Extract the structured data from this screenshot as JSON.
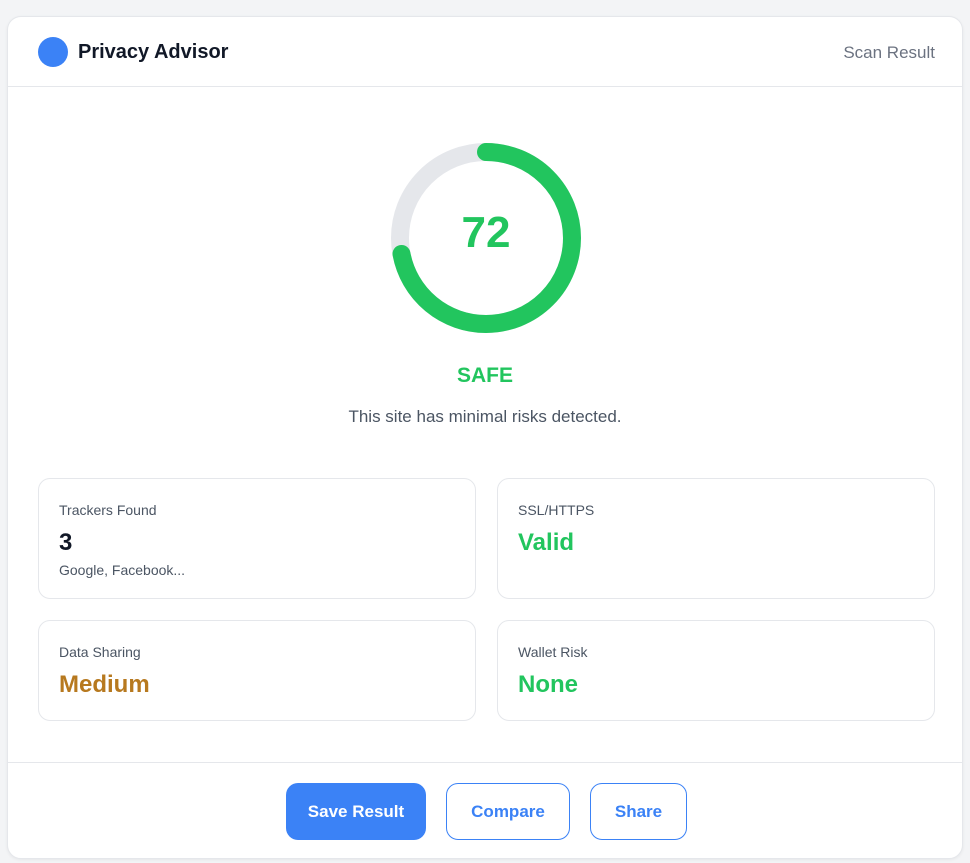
{
  "app": {
    "title": "Privacy Advisor",
    "header_right": "Scan Result"
  },
  "score": {
    "value": 72,
    "max": 100,
    "status": "SAFE",
    "description": "This site has minimal risks detected."
  },
  "stats": [
    {
      "title": "Trackers Found",
      "value": "3",
      "sub": "Google, Facebook...",
      "color": "#111827"
    },
    {
      "title": "SSL/HTTPS",
      "value": "Valid",
      "sub": "",
      "color": "#22c55e"
    },
    {
      "title": "Data Sharing",
      "value": "Medium",
      "sub": "",
      "color": "#b7791f"
    },
    {
      "title": "Wallet Risk",
      "value": "None",
      "sub": "",
      "color": "#22c55e"
    }
  ],
  "buttons": {
    "save": "Save Result",
    "compare": "Compare",
    "share": "Share"
  },
  "colors": {
    "accent": "#3b82f6",
    "safe": "#22c55e",
    "warning": "#b7791f",
    "track": "#e5e7eb"
  }
}
